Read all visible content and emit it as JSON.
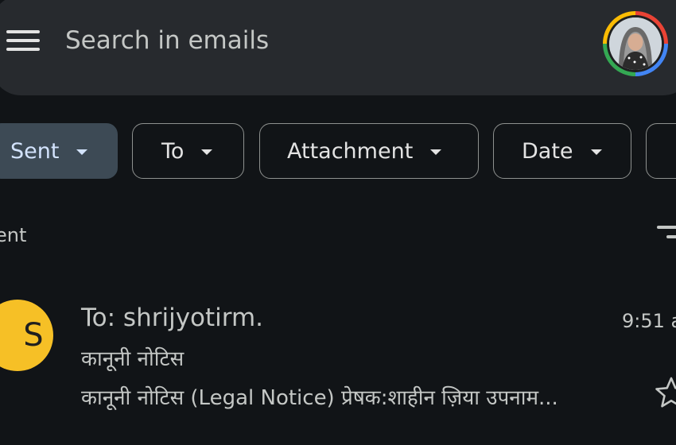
{
  "search": {
    "placeholder": "Search in emails"
  },
  "icons": {
    "menu": "hamburger-menu-icon",
    "avatar": "account-avatar",
    "dropdown": "caret-down-icon",
    "filter": "sort-filter-icon",
    "star": "star-outline-icon"
  },
  "colors": {
    "background": "#111417",
    "search_bar": "#272a2e",
    "selected_chip": "#3d4a55",
    "sender_avatar": "#f6c026"
  },
  "chips": [
    {
      "label": "Sent",
      "selected": true
    },
    {
      "label": "To",
      "selected": false
    },
    {
      "label": "Attachment",
      "selected": false
    },
    {
      "label": "Date",
      "selected": false
    }
  ],
  "section": {
    "label": "ent"
  },
  "email": {
    "initial": "S",
    "to": "To: shrijyotirm.",
    "time": "9:51 a",
    "subject": "कानूनी नोटिस",
    "snippet": "कानूनी नोटिस (Legal Notice) प्रेषक:शाहीन ज़िया उपनाम..."
  }
}
